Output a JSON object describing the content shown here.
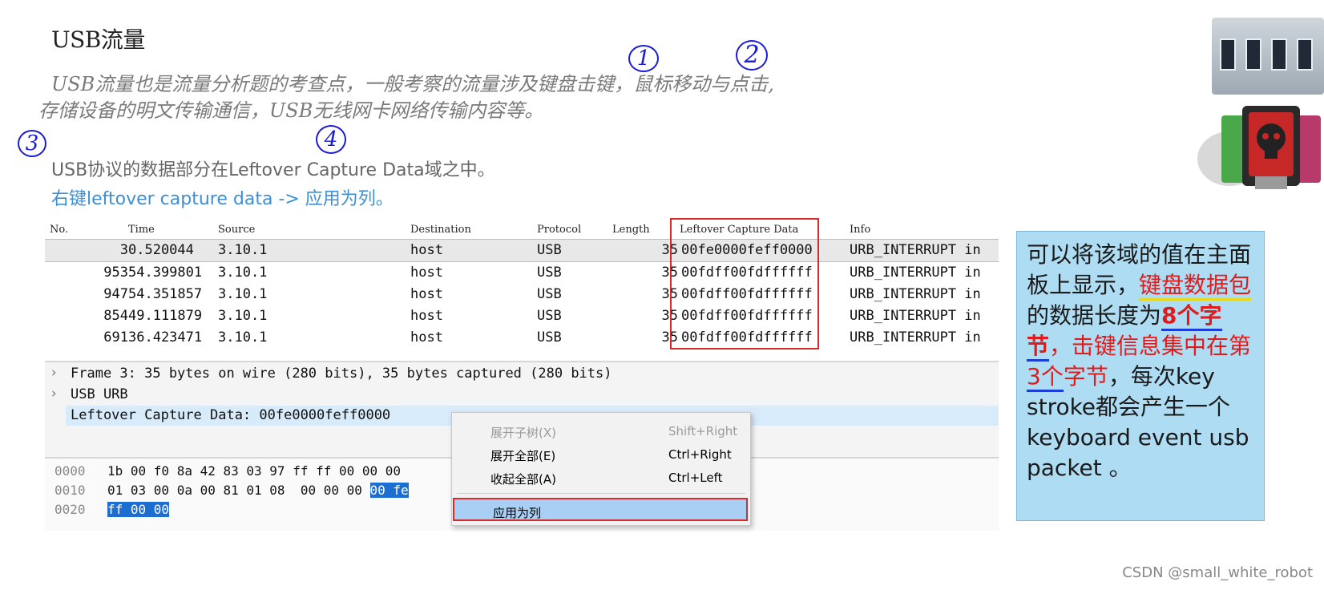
{
  "slide": {
    "title": "USB流量",
    "intro_line1": "USB流量也是流量分析题的考查点，一般考察的流量涉及键盘击键，鼠标移动与点击,",
    "intro_line2": "存储设备的明文传输通信，USB无线网卡网络传输内容等。",
    "desc1": "USB协议的数据部分在Leftover Capture Data域之中。",
    "desc2": "右键leftover capture data -> 应用为列。",
    "marks": [
      "1",
      "2",
      "3",
      "4"
    ]
  },
  "packet_list": {
    "columns": [
      "No.",
      "Time",
      "Source",
      "Destination",
      "Protocol",
      "Length",
      "Leftover Capture Data",
      "Info"
    ],
    "rows": [
      {
        "no": "3",
        "time": "0.520044",
        "source": "3.10.1",
        "destination": "host",
        "protocol": "USB",
        "length": "35",
        "data": "00fe0000feff0000",
        "info": "URB_INTERRUPT in"
      },
      {
        "no": "953",
        "time": "54.399801",
        "source": "3.10.1",
        "destination": "host",
        "protocol": "USB",
        "length": "35",
        "data": "00fdff00fdffffff",
        "info": "URB_INTERRUPT in"
      },
      {
        "no": "947",
        "time": "54.351857",
        "source": "3.10.1",
        "destination": "host",
        "protocol": "USB",
        "length": "35",
        "data": "00fdff00fdffffff",
        "info": "URB_INTERRUPT in"
      },
      {
        "no": "854",
        "time": "49.111879",
        "source": "3.10.1",
        "destination": "host",
        "protocol": "USB",
        "length": "35",
        "data": "00fdff00fdffffff",
        "info": "URB_INTERRUPT in"
      },
      {
        "no": "691",
        "time": "36.423471",
        "source": "3.10.1",
        "destination": "host",
        "protocol": "USB",
        "length": "35",
        "data": "00fdff00fdffffff",
        "info": "URB_INTERRUPT in"
      }
    ]
  },
  "details": {
    "frame": "Frame 3: 35 bytes on wire (280 bits), 35 bytes captured (280 bits)",
    "usb": "USB URB",
    "leftover": "Leftover Capture Data: 00fe0000feff0000"
  },
  "bytes": {
    "rows": [
      {
        "offset": "0000",
        "hex": "1b 00 f0 8a 42 83 03 97  ff ff 00 00 00",
        "sel": ""
      },
      {
        "offset": "0010",
        "hex": "01 03 00 0a 00 81 01 08  00 00 00 ",
        "sel": "00 fe"
      },
      {
        "offset": "0020",
        "hex": "",
        "sel": "ff 00 00"
      }
    ]
  },
  "context_menu": {
    "items": [
      {
        "label": "展开子树(X)",
        "shortcut": "Shift+Right"
      },
      {
        "label": "展开全部(E)",
        "shortcut": "Ctrl+Right"
      },
      {
        "label": "收起全部(A)",
        "shortcut": "Ctrl+Left"
      },
      {
        "label": "应用为列",
        "shortcut": ""
      }
    ]
  },
  "note": {
    "p1": "可以将该域的值在主面板上显示，",
    "p2": "键盘数据包",
    "p3": "的数据长度为",
    "p4": "8个字节",
    "p5": "，击键信息集中在第",
    "p6": "3个",
    "p7": "字节",
    "p8": "，每次key stroke都会产生一个keyboard event usb packet 。"
  },
  "watermark": "CSDN @small_white_robot",
  "colors": {
    "accent_blue": "#3d8fd6",
    "highlight_red": "#d62b2b",
    "note_bg": "#aedcf3",
    "selection_blue": "#1c6fd1"
  }
}
